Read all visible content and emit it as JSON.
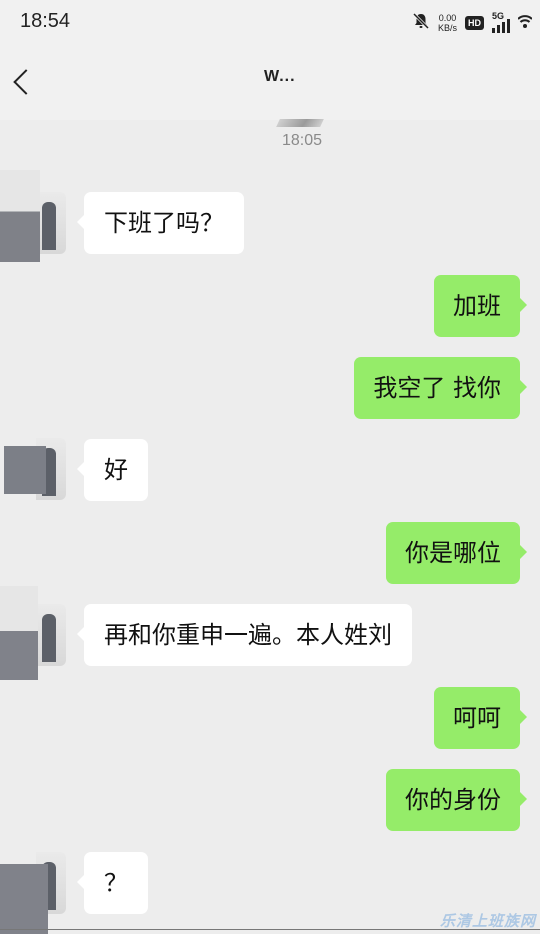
{
  "status_bar": {
    "time": "18:54",
    "net_speed_value": "0.00",
    "net_speed_unit": "KB/s",
    "hd_label": "HD",
    "network_label": "5G"
  },
  "nav": {
    "title": "W..."
  },
  "timestamp": "18:05",
  "messages": [
    {
      "side": "in",
      "text": "下班了吗？"
    },
    {
      "side": "out",
      "text": "加班"
    },
    {
      "side": "out",
      "text": "我空了 找你"
    },
    {
      "side": "in",
      "text": "好"
    },
    {
      "side": "out",
      "text": "你是哪位"
    },
    {
      "side": "in",
      "text": "再和你重申一遍。本人姓刘"
    },
    {
      "side": "out",
      "text": "呵呵"
    },
    {
      "side": "out",
      "text": "你的身份"
    },
    {
      "side": "in",
      "text": "？"
    }
  ],
  "watermark": "乐清上班族网",
  "colors": {
    "background": "#ededed",
    "incoming_bubble": "#ffffff",
    "outgoing_bubble": "#95ec69",
    "text": "#111111",
    "timestamp": "#8a8a8a"
  },
  "icons": {
    "mute": "bell-off-icon",
    "signal": "signal-icon",
    "wifi": "wifi-icon",
    "back": "back-icon"
  }
}
